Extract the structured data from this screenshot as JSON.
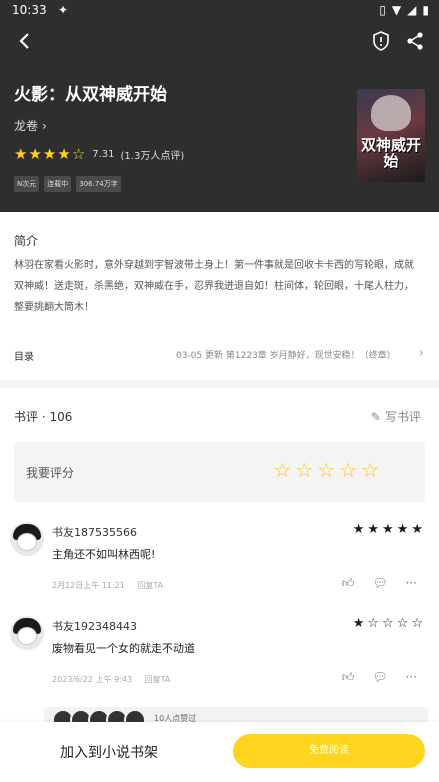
{
  "status": {
    "time": "10:33",
    "app_icon": "bug-icon"
  },
  "book": {
    "title": "火影：从双神威开始",
    "author": "龙卷",
    "rating": 7.31,
    "rating_count": "(1.3万人点评)",
    "stars_filled": 4.5,
    "tags": [
      "N次元",
      "连载中",
      "306.74万字"
    ],
    "cover_text": "双神威开始",
    "cover_small": "火影"
  },
  "intro": {
    "label": "简介",
    "text": "林羽在家看火影时，意外穿越到宇智波带土身上！第一件事就是回收卡卡西的写轮眼，成就双神威！送走斑，杀黑绝，双神威在手，忍界我迸退自如！柱间体，轮回眼，十尾人柱力，整要挑翻大筒木！"
  },
  "toc": {
    "label": "目录",
    "date": "03-05",
    "update_label": "更新",
    "latest": "第1223章 岁月静好，现世安稳！（终章）"
  },
  "reviews": {
    "title": "书评 · 106",
    "write_label": "写书评",
    "my_rating_label": "我要评分",
    "items": [
      {
        "name": "书友187535566",
        "stars": 5,
        "text": "主角还不如叫林西呢!",
        "date": "2月12日上午 11:21",
        "reply": "回复TA"
      },
      {
        "name": "书友192348443",
        "stars": 1,
        "text": "废物看见一个女的就走不动道",
        "date": "2023/6/22 上午 9:43",
        "reply": "回复TA"
      }
    ],
    "likes_text": "10人点赞过"
  },
  "bottom": {
    "shelf_label": "加入到小说书架",
    "read_label": "免费阅读"
  },
  "colors": {
    "accent": "#ffd41f",
    "header_bg": "#2e2e2e",
    "star": "#ffd21f"
  }
}
